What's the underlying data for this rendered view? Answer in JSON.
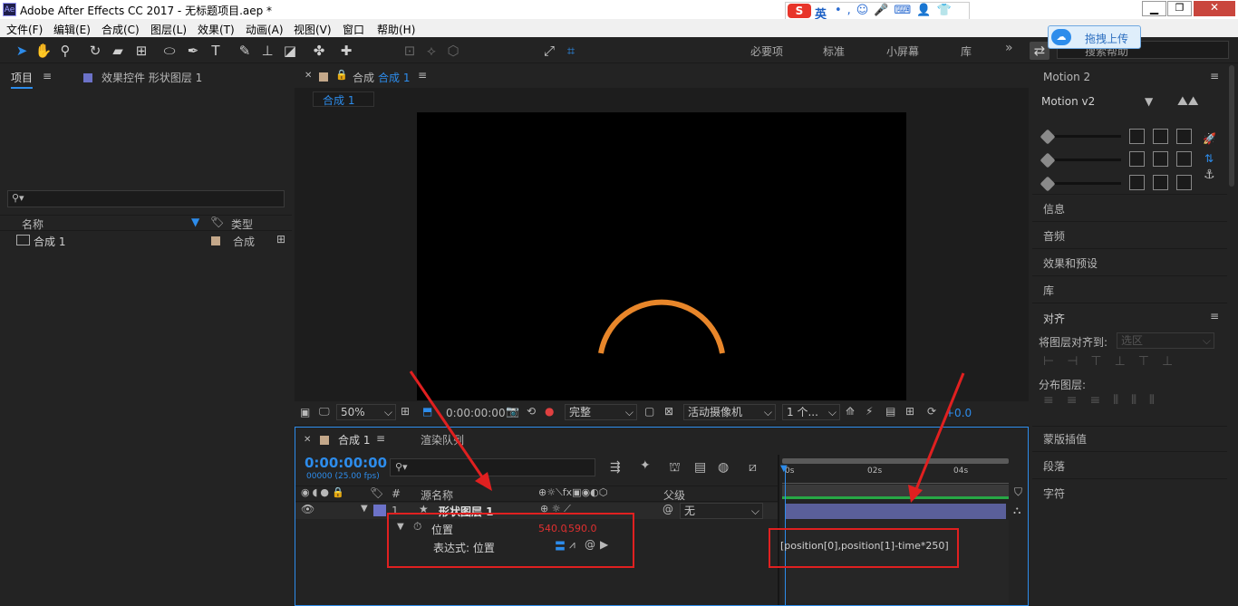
{
  "window": {
    "title": "Adobe After Effects CC 2017 - 无标题项目.aep *",
    "logo": "Ae"
  },
  "menu": [
    "文件(F)",
    "编辑(E)",
    "合成(C)",
    "图层(L)",
    "效果(T)",
    "动画(A)",
    "视图(V)",
    "窗口",
    "帮助(H)"
  ],
  "toolbar": {
    "align_label": "对齐",
    "workspaces": [
      "必要项",
      "标准",
      "小屏幕",
      "库"
    ],
    "search_placeholder": "搜索帮助",
    "upload_label": "拖拽上传",
    "ime_label": "英"
  },
  "project": {
    "tab_project": "项目",
    "tab_effects": "效果控件 形状图层 1",
    "col_name": "名称",
    "col_type": "类型",
    "items": [
      {
        "name": "合成 1",
        "type": "合成"
      }
    ]
  },
  "comp_viewer": {
    "tab_prefix": "合成",
    "tab_name": "合成 1",
    "breadcrumb": "合成 1",
    "zoom": "50%",
    "timecode": "0:00:00:00",
    "quality": "完整",
    "camera": "活动摄像机",
    "views": "1 个...",
    "exposure": "+0.0"
  },
  "timeline": {
    "tab_comp": "合成 1",
    "tab_render": "渲染队列",
    "timecode": "0:00:00:00",
    "frames": "00000 (25.00 fps)",
    "col_hash": "#",
    "col_source": "源名称",
    "col_parent": "父级",
    "ruler": [
      "0s",
      "02s",
      "04s"
    ],
    "layer": {
      "index": "1",
      "name": "形状图层 1",
      "parent": "无"
    },
    "property": {
      "name": "位置",
      "value_x": "540.0",
      "value_y": "590.0"
    },
    "expression_label": "表达式: 位置",
    "expression_text": "[position[0],position[1]-time*250]",
    "colors": {
      "accent": "#2d8ceb",
      "value_red": "#e03030",
      "layer_bar": "#5a5f9a",
      "arc": "#e8862a"
    }
  },
  "right_panel": {
    "motion_title": "Motion 2",
    "motion_version": "Motion v2",
    "sections": [
      "信息",
      "音频",
      "效果和预设",
      "库"
    ],
    "align_title": "对齐",
    "align_to_label": "将图层对齐到:",
    "align_to_value": "选区",
    "distribute_label": "分布图层:",
    "sections2": [
      "蒙版插值",
      "段落",
      "字符"
    ]
  }
}
